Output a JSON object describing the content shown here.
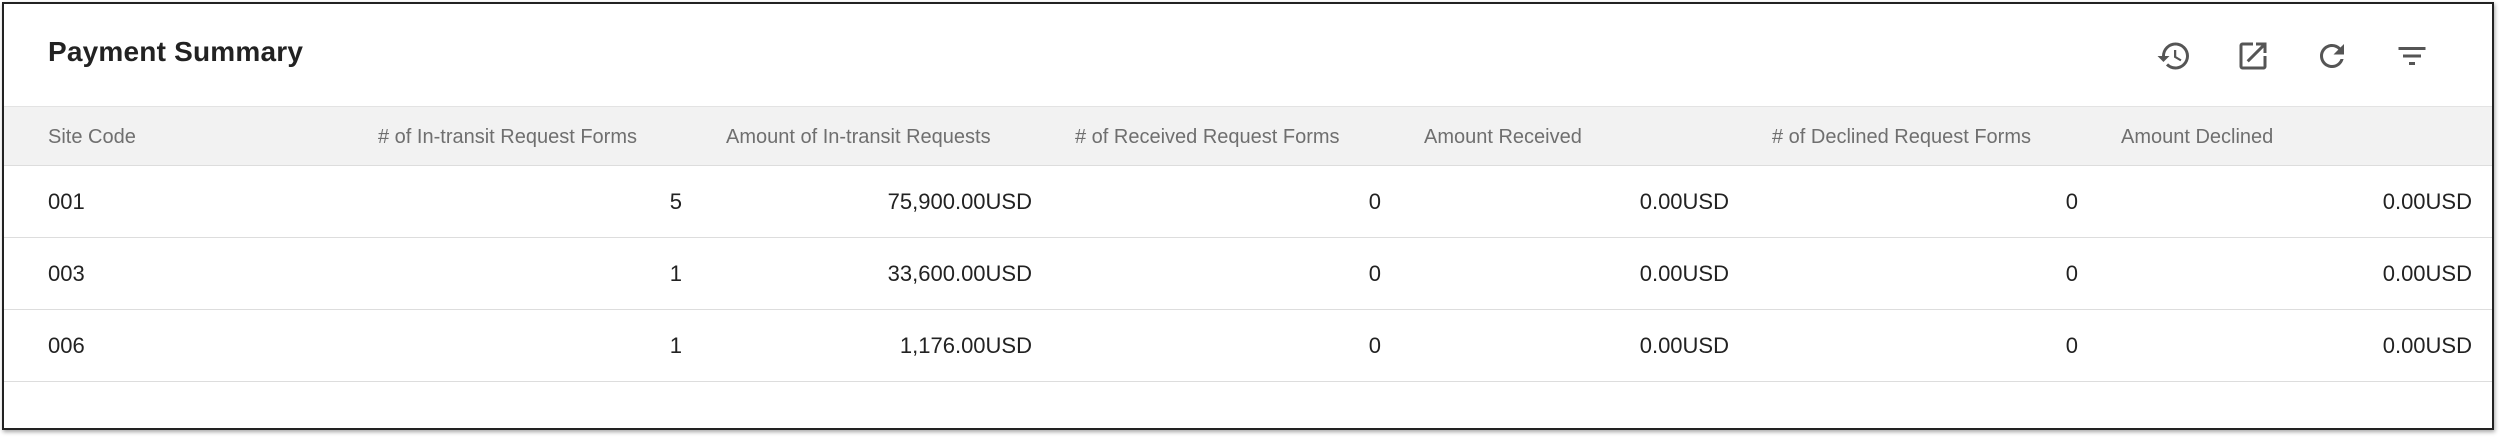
{
  "panel": {
    "title": "Payment Summary",
    "toolbar": [
      {
        "icon": "history-icon",
        "name": "history-button"
      },
      {
        "icon": "open-in-new-icon",
        "name": "open-external-button"
      },
      {
        "icon": "refresh-icon",
        "name": "refresh-button"
      },
      {
        "icon": "filter-icon",
        "name": "filter-button"
      }
    ]
  },
  "table": {
    "columns": [
      "Site Code",
      "# of In-transit Request Forms",
      "Amount of In-transit Requests",
      "# of Received Request Forms",
      "Amount Received",
      "# of Declined Request Forms",
      "Amount Declined"
    ],
    "rows": [
      [
        "001",
        "5",
        "75,900.00USD",
        "0",
        "0.00USD",
        "0",
        "0.00USD"
      ],
      [
        "003",
        "1",
        "33,600.00USD",
        "0",
        "0.00USD",
        "0",
        "0.00USD"
      ],
      [
        "006",
        "1",
        "1,176.00USD",
        "0",
        "0.00USD",
        "0",
        "0.00USD"
      ]
    ]
  },
  "colors": {
    "header_bg": "#f2f2f2",
    "header_text": "#6f6f6f",
    "text": "#222222",
    "icon": "#555555",
    "divider": "#dddddd"
  }
}
